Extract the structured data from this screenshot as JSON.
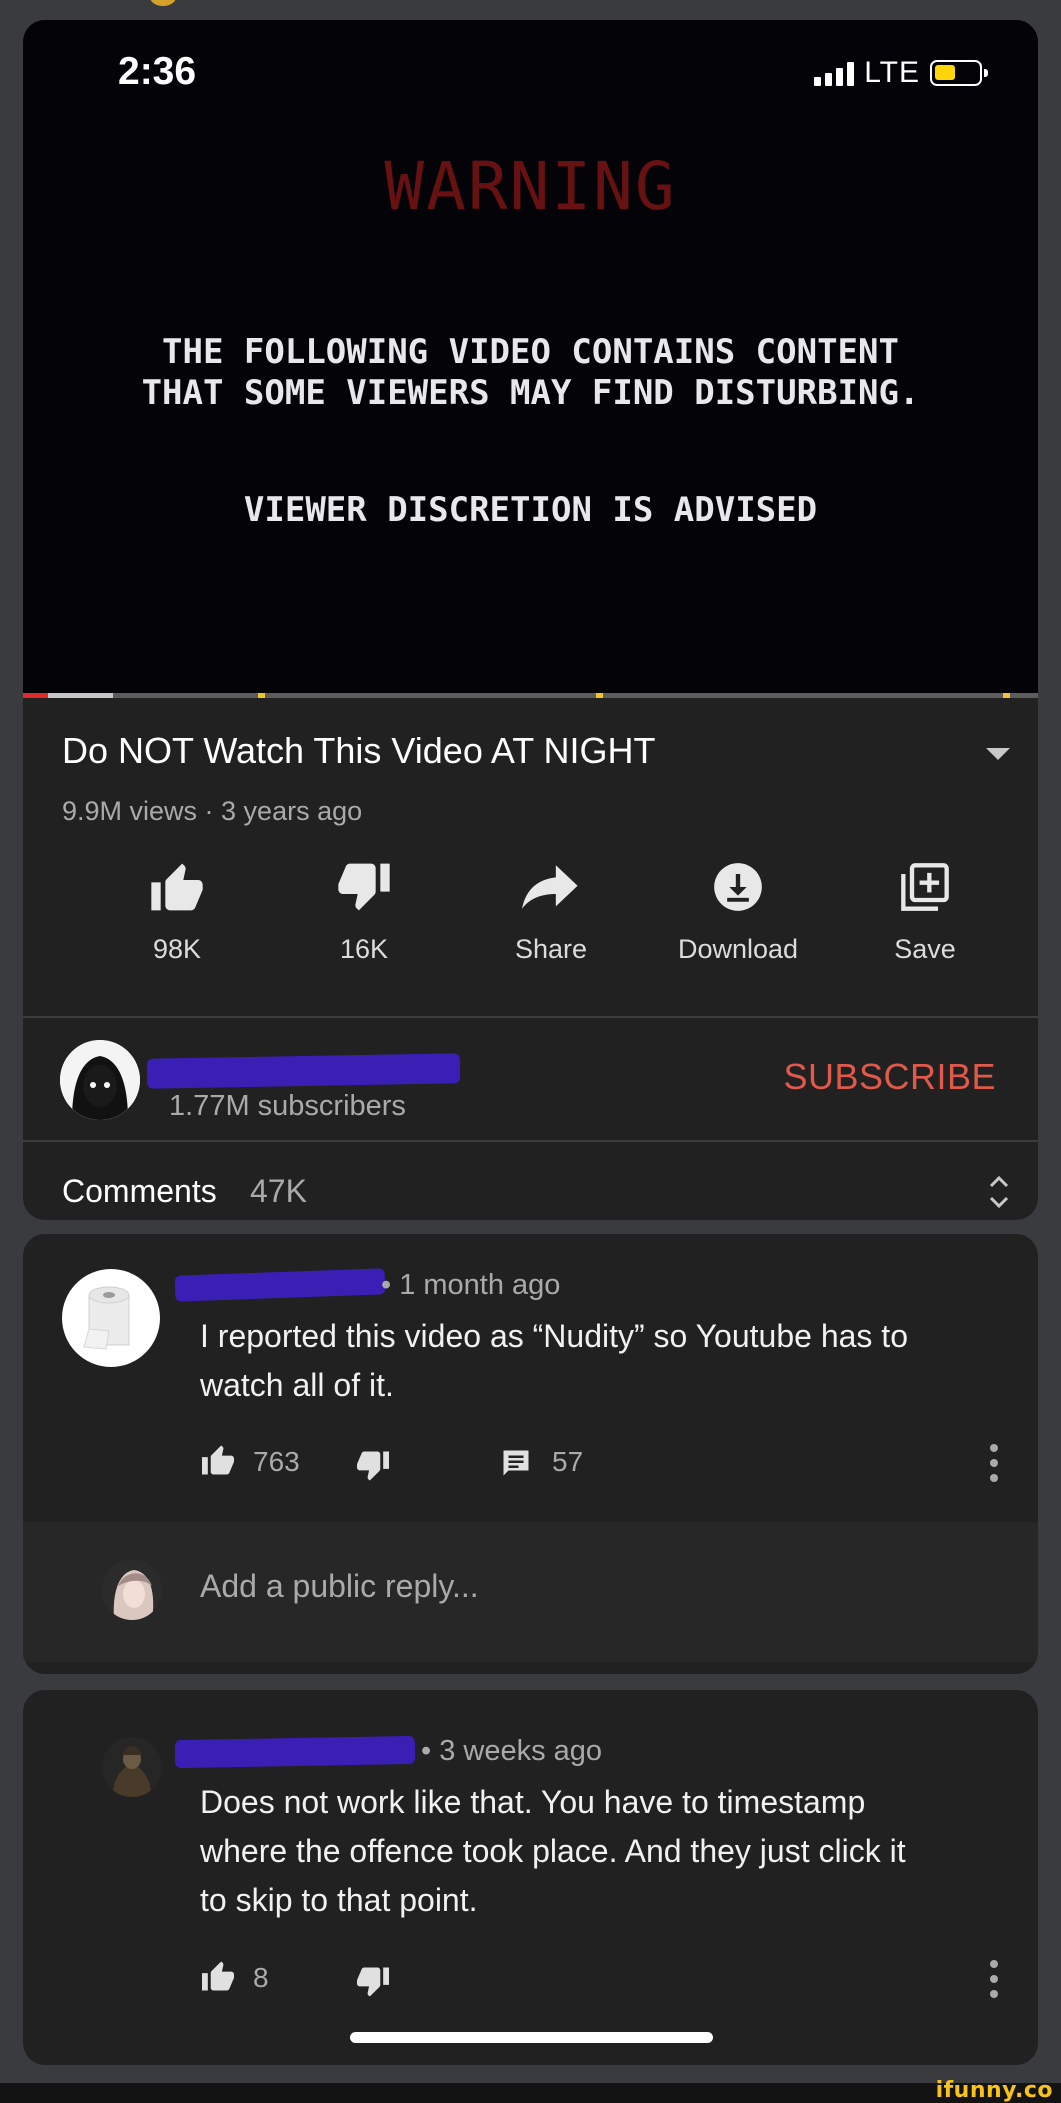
{
  "status_bar": {
    "time": "2:36",
    "network": "LTE"
  },
  "video": {
    "warning_title": "WARNING",
    "warning_line_1": "THE FOLLOWING VIDEO CONTAINS CONTENT",
    "warning_line_2": "THAT SOME VIEWERS MAY FIND DISTURBING.",
    "warning_line_3": "VIEWER DISCRETION IS ADVISED",
    "progress_fraction": 0.025
  },
  "info": {
    "title": "Do NOT Watch This Video AT NIGHT",
    "meta": "9.9M views · 3 years ago",
    "actions": [
      {
        "icon": "thumbs-up-icon",
        "label": "98K"
      },
      {
        "icon": "thumbs-down-icon",
        "label": "16K"
      },
      {
        "icon": "share-icon",
        "label": "Share"
      },
      {
        "icon": "download-icon",
        "label": "Download"
      },
      {
        "icon": "save-to-playlist-icon",
        "label": "Save"
      }
    ]
  },
  "channel": {
    "subscribers": "1.77M subscribers",
    "subscribe_label": "SUBSCRIBE"
  },
  "comments": {
    "label": "Comments",
    "count": "47K",
    "items": [
      {
        "time": "• 1 month ago",
        "text_line_1": "I reported this video as “Nudity” so Youtube has to",
        "text_line_2": "watch all of it.",
        "likes": "763",
        "replies": "57"
      },
      {
        "time": "• 3 weeks ago",
        "text_line_1": "Does not work like that. You have to timestamp",
        "text_line_2": "where the offence took place. And they just click it",
        "text_line_3": "to skip to that point.",
        "likes": "8"
      }
    ],
    "reply_placeholder": "Add a public reply..."
  },
  "watermark": "ifunny.co",
  "colors": {
    "accent_subscribe": "#e0594a",
    "progress_red": "#e02b2b",
    "redaction": "#3a1fb5",
    "background": "#212121"
  }
}
